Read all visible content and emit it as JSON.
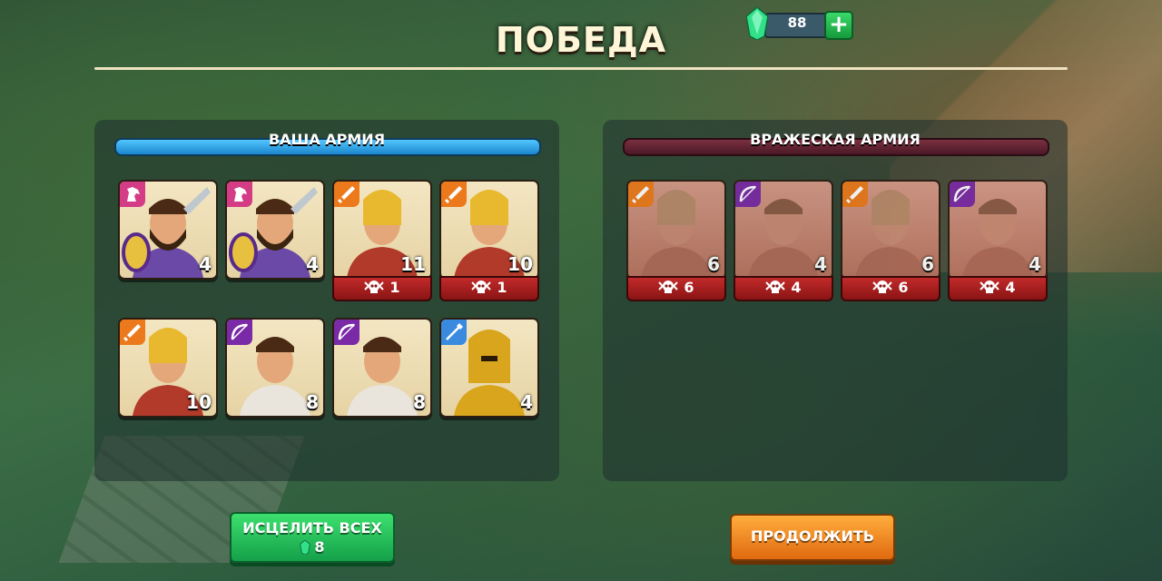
{
  "title": "ПОБЕДА",
  "currency": {
    "gems": "88",
    "plus_icon": "plus-icon",
    "gem_icon": "emerald-gem-icon"
  },
  "your_army": {
    "label": "ВАША АРМИЯ",
    "units": [
      {
        "type": "cavalry",
        "badge": "horse-icon",
        "count": "4",
        "losses": ""
      },
      {
        "type": "cavalry",
        "badge": "horse-icon",
        "count": "4",
        "losses": ""
      },
      {
        "type": "swordsman",
        "badge": "sword-icon",
        "count": "11",
        "losses": "1"
      },
      {
        "type": "swordsman",
        "badge": "sword-icon",
        "count": "10",
        "losses": "1"
      },
      {
        "type": "swordsman",
        "badge": "sword-icon",
        "count": "10",
        "losses": ""
      },
      {
        "type": "archer",
        "badge": "bow-icon",
        "count": "8",
        "losses": ""
      },
      {
        "type": "archer",
        "badge": "bow-icon",
        "count": "8",
        "losses": ""
      },
      {
        "type": "spearman",
        "badge": "spear-icon",
        "count": "4",
        "losses": ""
      }
    ]
  },
  "enemy_army": {
    "label": "ВРАЖЕСКАЯ АРМИЯ",
    "units": [
      {
        "type": "swordsman",
        "badge": "sword-icon",
        "count": "6",
        "losses": "6"
      },
      {
        "type": "archer",
        "badge": "bow-icon",
        "count": "4",
        "losses": "4"
      },
      {
        "type": "swordsman",
        "badge": "sword-icon",
        "count": "6",
        "losses": "6"
      },
      {
        "type": "archer",
        "badge": "bow-icon",
        "count": "4",
        "losses": "4"
      }
    ]
  },
  "buttons": {
    "heal_label": "ИСЦЕЛИТЬ ВСЕХ",
    "heal_cost": "8",
    "continue_label": "ПРОДОЛЖИТЬ"
  },
  "colors": {
    "ally_bar": "#2aa6e8",
    "enemy_bar": "#6a2434",
    "heal_button": "#22c05a",
    "continue_button": "#f08a22",
    "loss_badge": "#b01f1f"
  }
}
